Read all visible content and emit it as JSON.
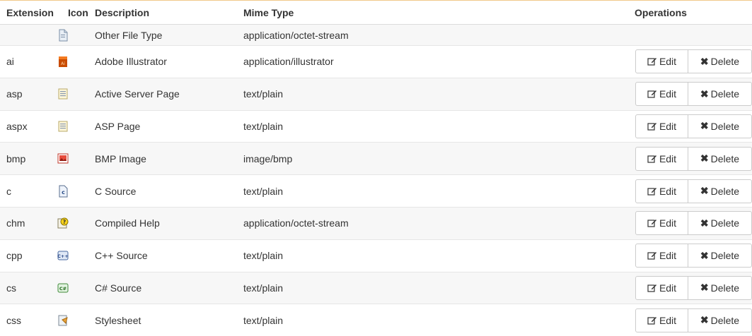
{
  "table": {
    "headers": {
      "extension": "Extension",
      "icon": "Icon",
      "description": "Description",
      "mime": "Mime Type",
      "operations": "Operations"
    },
    "default_row": {
      "description": "Other File Type",
      "mime": "application/octet-stream",
      "icon": "generic-file-icon"
    },
    "rows": [
      {
        "ext": "ai",
        "description": "Adobe Illustrator",
        "mime": "application/illustrator",
        "icon": "illustrator-file-icon"
      },
      {
        "ext": "asp",
        "description": "Active Server Page",
        "mime": "text/plain",
        "icon": "asp-file-icon"
      },
      {
        "ext": "aspx",
        "description": "ASP Page",
        "mime": "text/plain",
        "icon": "aspx-file-icon"
      },
      {
        "ext": "bmp",
        "description": "BMP Image",
        "mime": "image/bmp",
        "icon": "bmp-image-icon"
      },
      {
        "ext": "c",
        "description": "C Source",
        "mime": "text/plain",
        "icon": "c-source-icon"
      },
      {
        "ext": "chm",
        "description": "Compiled Help",
        "mime": "application/octet-stream",
        "icon": "compiled-help-icon"
      },
      {
        "ext": "cpp",
        "description": "C++ Source",
        "mime": "text/plain",
        "icon": "cpp-source-icon"
      },
      {
        "ext": "cs",
        "description": "C# Source",
        "mime": "text/plain",
        "icon": "csharp-source-icon"
      },
      {
        "ext": "css",
        "description": "Stylesheet",
        "mime": "text/plain",
        "icon": "stylesheet-icon"
      }
    ],
    "edit_label": "Edit",
    "delete_label": "Delete"
  },
  "colors": {
    "header_border": "#f0c98a",
    "row_border": "#e6e6e6",
    "shaded_row": "#f7f7f7",
    "text": "#333333"
  }
}
